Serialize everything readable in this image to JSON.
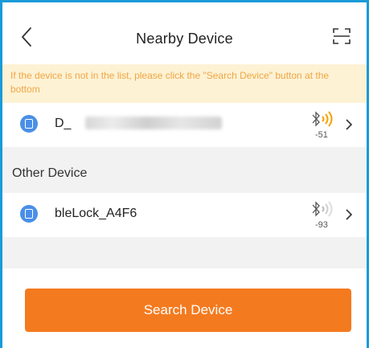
{
  "header": {
    "title": "Nearby Device",
    "back_icon": "chevron-left-icon",
    "scan_icon": "scan-icon"
  },
  "notice": {
    "text": "If the device is not in the list, please click the \"Search Device\" button at the bottom"
  },
  "my_device": {
    "name_prefix": "D_",
    "rssi": "-51",
    "signal_color": "#f5a000"
  },
  "section": {
    "other_label": "Other Device"
  },
  "other_devices": [
    {
      "name": "bleLock_A4F6",
      "rssi": "-93",
      "signal_color": "#bbbbbb"
    }
  ],
  "footer": {
    "search_button": "Search Device"
  },
  "colors": {
    "accent": "#f47a1f",
    "notice_bg": "#fdf2d4",
    "notice_text": "#f0a645",
    "device_icon": "#4a8fe7",
    "frame": "#1a9ad8"
  }
}
